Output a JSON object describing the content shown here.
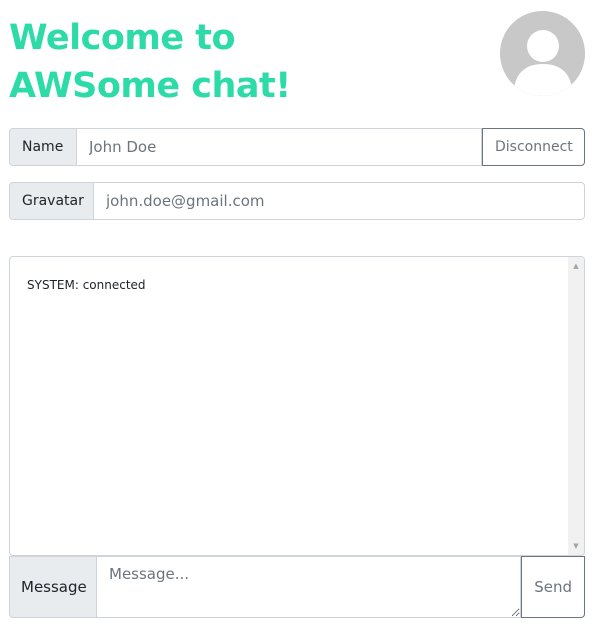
{
  "header": {
    "title_line1": "Welcome to",
    "title_line2": "AWSome chat!",
    "accent_color": "#2ddba8"
  },
  "avatar": {
    "icon": "default-user-avatar-icon"
  },
  "name_row": {
    "label": "Name",
    "value": "John Doe",
    "button_label": "Disconnect"
  },
  "gravatar_row": {
    "label": "Gravatar",
    "value": "john.doe@gmail.com"
  },
  "log": {
    "lines": [
      "SYSTEM: connected"
    ]
  },
  "message_row": {
    "label": "Message",
    "placeholder": "Message...",
    "button_label": "Send"
  }
}
